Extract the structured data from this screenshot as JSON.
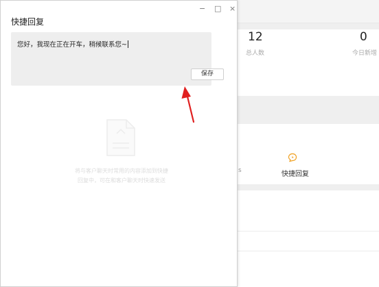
{
  "background": {
    "stats": [
      {
        "value": "12",
        "label": "总人数"
      },
      {
        "value": "0",
        "label": "今日新增"
      }
    ],
    "tools": {
      "quick_reply_label": "快捷回复",
      "edge_mark": "s"
    },
    "colors": {
      "accent": "#f0a020"
    }
  },
  "dialog": {
    "title": "快捷回复",
    "window_controls": {
      "minimize": "−",
      "maximize": "□",
      "close": "×"
    },
    "editor_text": "您好，我现在正在开车，稍候联系您~",
    "save_label": "保存",
    "empty_state": {
      "line1": "将与客户聊天时常用的内容添加到快捷",
      "line2": "回复中，可在和客户聊天时快速发送"
    }
  },
  "annotation": {
    "arrow_color": "#e02020"
  }
}
